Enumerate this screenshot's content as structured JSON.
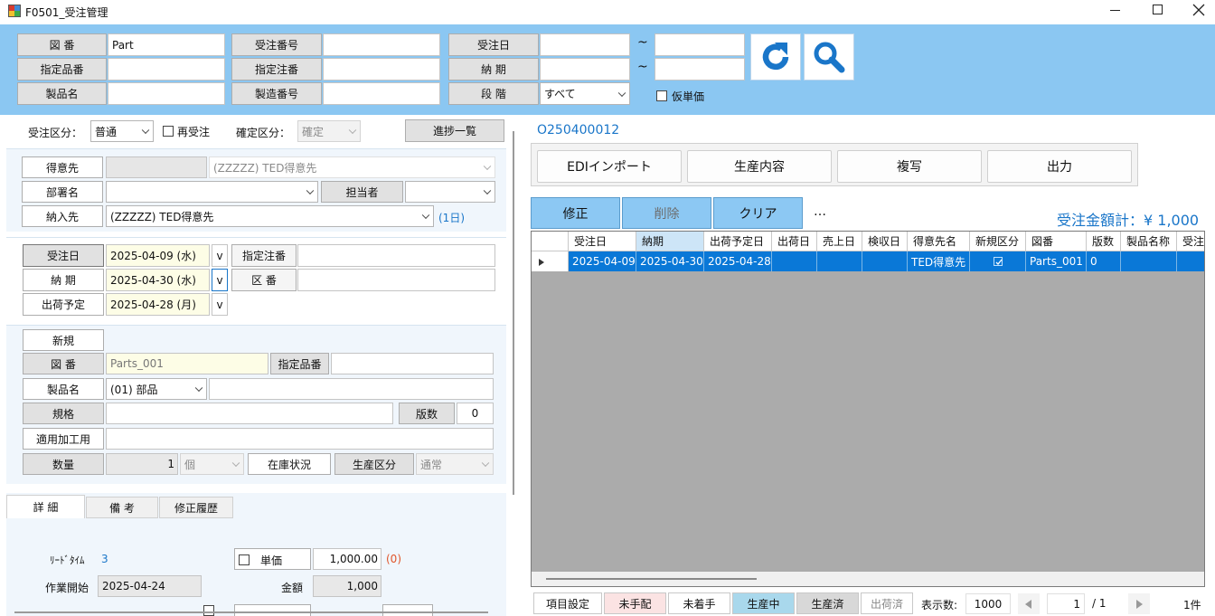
{
  "window": {
    "title": "F0501_受注管理"
  },
  "search": {
    "labels": {
      "zuban": "図 番",
      "shitei_hinban": "指定品番",
      "seihinmei": "製品名",
      "juchu_bango": "受注番号",
      "shitei_chuban": "指定注番",
      "seizo_bango": "製造番号",
      "juchubi": "受注日",
      "noki": "納 期",
      "dankai": "段 階"
    },
    "zuban_value": "Part",
    "tilde": "~",
    "dankai_value": "すべて",
    "kari_tanka_label": "仮単価"
  },
  "left": {
    "juchu_kubun_label": "受注区分：",
    "juchu_kubun_value": "普通",
    "sai_juchu_label": "再受注",
    "kakutei_kubun_label": "確定区分：",
    "kakutei_kubun_value": "確定",
    "shinchoku_button": "進捗一覧",
    "tokuisaki_label": "得意先",
    "tokuisaki_value": "(ZZZZZ) TED得意先",
    "busho_label": "部署名",
    "tantousha_label": "担当者",
    "nonyusaki_label": "納入先",
    "nonyusaki_value": "(ZZZZZ) TED得意先",
    "nonyusaki_days": "(1日)",
    "juchubi_label": "受注日",
    "juchubi_value": "2025-04-09 (水)",
    "noki_label": "納 期",
    "noki_value": "2025-04-30 (水)",
    "shukka_label": "出荷予定",
    "shukka_value": "2025-04-28 (月)",
    "v_btn": "v",
    "shitei_chuban_label": "指定注番",
    "kuban_label": "区 番",
    "shinki_label": "新規",
    "zuban_label": "図 番",
    "zuban_value": "Parts_001",
    "shitei_hinban_label": "指定品番",
    "seihinmei_label": "製品名",
    "seihinmei_value": "(01) 部品",
    "kikaku_label": "規格",
    "hansu_label": "版数",
    "hansu_value": "0",
    "tekiyo_label": "適用加工用",
    "suryo_label": "数量",
    "suryo_value": "1",
    "tani_value": "個",
    "zaiko_button": "在庫状況",
    "seisan_kubun_label": "生産区分",
    "seisan_kubun_value": "通常",
    "tabs": [
      "詳 細",
      "備 考",
      "修正履歴"
    ],
    "lead_time_label": "ﾘｰﾄﾞﾀｲﾑ",
    "lead_time_value": "3",
    "tanka_label": "単価",
    "tanka_value": "1,000.00",
    "tanka_note": "(0)",
    "sagyo_label": "作業開始",
    "sagyo_value": "2025-04-24",
    "kingaku_label": "金額",
    "kingaku_value": "1,000"
  },
  "right": {
    "order_number": "O250400012",
    "toolbar": [
      "EDIインポート",
      "生産内容",
      "複写",
      "出力"
    ],
    "actions": {
      "edit": "修正",
      "delete": "削除",
      "clear": "クリア",
      "more": "…"
    },
    "total_label": "受注金額計：¥ 1,000",
    "grid": {
      "headers": [
        "受注日",
        "納期",
        "出荷予定日",
        "出荷日",
        "売上日",
        "検収日",
        "得意先名",
        "新規区分",
        "図番",
        "版数",
        "製品名称",
        "受注"
      ],
      "row": [
        "2025-04-09",
        "2025-04-30",
        "2025-04-28",
        "",
        "",
        "",
        "TED得意先",
        "",
        "Parts_001",
        "0",
        "",
        ""
      ]
    },
    "status": {
      "item_settings": "項目設定",
      "legend": [
        "未手配",
        "未着手",
        "生産中",
        "生産済",
        "出荷済"
      ],
      "display_count_label": "表示数:",
      "display_count": "1000",
      "page": "1",
      "page_total": "/ 1",
      "count": "1件"
    }
  },
  "colors": {
    "header_bg": "#8bc7f2",
    "accent": "#0a78d7",
    "panel_bg": "#f0f6fc"
  }
}
